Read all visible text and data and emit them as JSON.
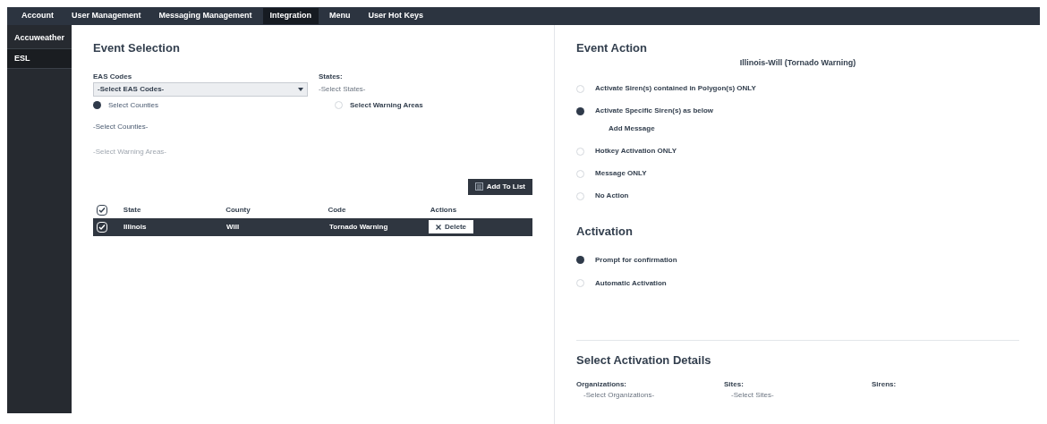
{
  "nav_tabs": [
    {
      "label": "Account",
      "selected": false
    },
    {
      "label": "User Management",
      "selected": false
    },
    {
      "label": "Messaging Management",
      "selected": false
    },
    {
      "label": "Integration",
      "selected": true
    },
    {
      "label": "Menu",
      "selected": false
    },
    {
      "label": "User Hot Keys",
      "selected": false
    }
  ],
  "sidebar": {
    "items": [
      {
        "label": "Accuweather",
        "selected": false
      },
      {
        "label": "ESL",
        "selected": true
      }
    ]
  },
  "event_selection": {
    "title": "Event Selection",
    "eas_codes": {
      "label": "EAS Codes",
      "value": "-Select EAS Codes-"
    },
    "states": {
      "label": "States:",
      "value": "-Select States-"
    },
    "area_options": [
      {
        "label": "Select Counties",
        "selected": true
      },
      {
        "label": "Select Warning Areas",
        "selected": false
      }
    ],
    "counties_value": "-Select Counties-",
    "warning_areas_value": "-Select Warning Areas-",
    "add_button": "Add To List",
    "table": {
      "header_checked": true,
      "columns": [
        "State",
        "County",
        "Code",
        "Actions"
      ],
      "rows": [
        {
          "checked": true,
          "selected": true,
          "cells": [
            "Illinois",
            "Will",
            "Tornado Warning"
          ],
          "action": "Delete"
        }
      ]
    }
  },
  "event_action": {
    "title": "Event Action",
    "event_name": "Illinois-Will (Tornado Warning)",
    "options": [
      {
        "label": "Activate Siren(s) contained in Polygon(s) ONLY",
        "selected": false
      },
      {
        "label": "Activate Specific Siren(s) as below",
        "selected": true,
        "sub": "Add Message"
      },
      {
        "label": "Hotkey Activation ONLY",
        "selected": false
      },
      {
        "label": "Message ONLY",
        "selected": false
      },
      {
        "label": "No Action",
        "selected": false
      }
    ]
  },
  "activation": {
    "title": "Activation",
    "options": [
      {
        "label": "Prompt for confirmation",
        "selected": true
      },
      {
        "label": "Automatic Activation",
        "selected": false
      }
    ]
  },
  "activation_details": {
    "title": "Select Activation Details",
    "fields": [
      {
        "label": "Organizations:",
        "value": "-Select Organizations-"
      },
      {
        "label": "Sites:",
        "value": "-Select Sites-"
      },
      {
        "label": "Sirens:"
      }
    ]
  }
}
